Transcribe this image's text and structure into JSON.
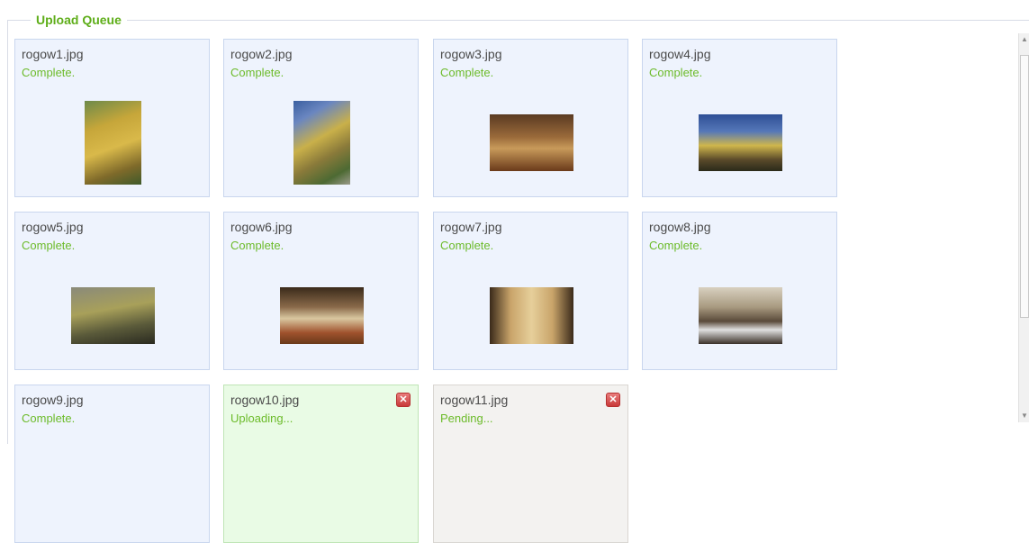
{
  "queue_title": "Upload Queue",
  "cancel_glyph": "✕",
  "items": [
    {
      "filename": "rogow1.jpg",
      "status": "Complete."
    },
    {
      "filename": "rogow2.jpg",
      "status": "Complete."
    },
    {
      "filename": "rogow3.jpg",
      "status": "Complete."
    },
    {
      "filename": "rogow4.jpg",
      "status": "Complete."
    },
    {
      "filename": "rogow5.jpg",
      "status": "Complete."
    },
    {
      "filename": "rogow6.jpg",
      "status": "Complete."
    },
    {
      "filename": "rogow7.jpg",
      "status": "Complete."
    },
    {
      "filename": "rogow8.jpg",
      "status": "Complete."
    },
    {
      "filename": "rogow9.jpg",
      "status": "Complete."
    },
    {
      "filename": "rogow10.jpg",
      "status": "Uploading..."
    },
    {
      "filename": "rogow11.jpg",
      "status": "Pending..."
    }
  ]
}
